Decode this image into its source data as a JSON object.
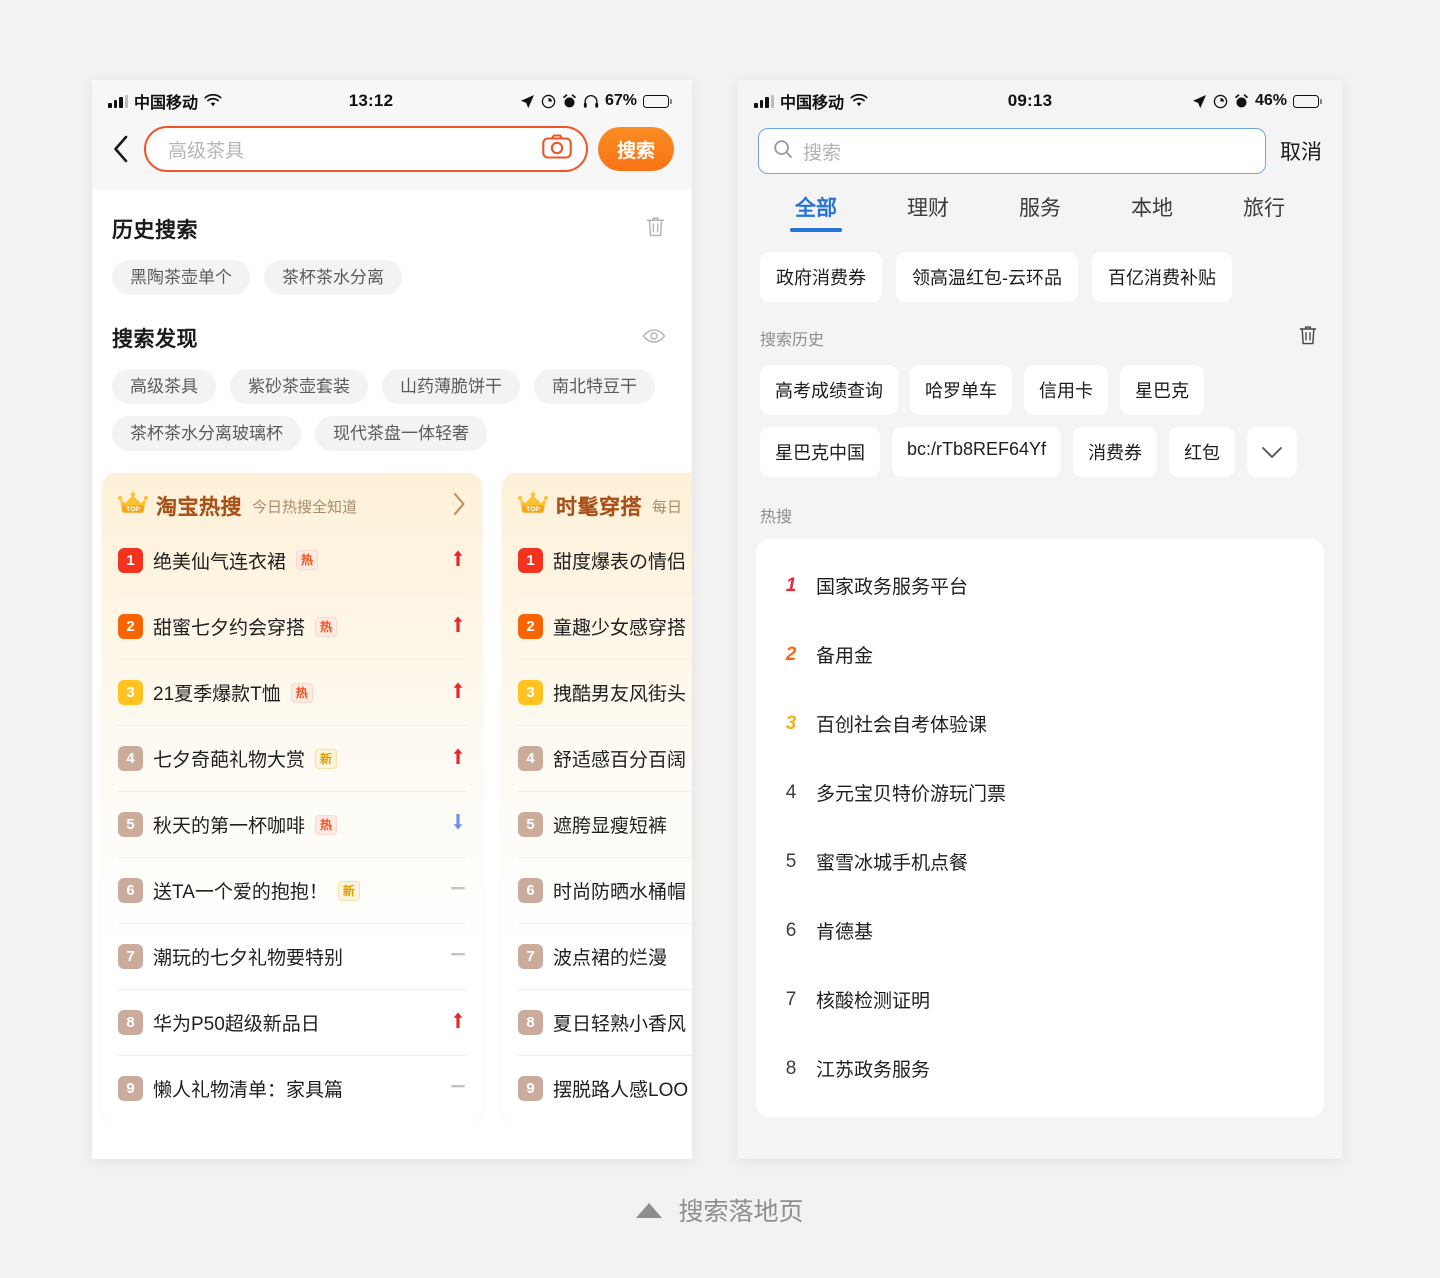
{
  "caption": {
    "text": "搜索落地页",
    "icon": "triangle-up-icon"
  },
  "left_phone": {
    "status": {
      "carrier": "中国移动",
      "time": "13:12",
      "battery_percent": "67%",
      "icons": [
        "signal-bars-icon",
        "wifi-icon",
        "location-arrow-icon",
        "do-not-disturb-icon",
        "alarm-icon",
        "headphones-icon",
        "battery-icon"
      ]
    },
    "search": {
      "back_icon": "chevron-left-icon",
      "placeholder": "高级茶具",
      "camera_icon": "camera-icon",
      "button_label": "搜索"
    },
    "history": {
      "title": "历史搜索",
      "delete_icon": "trash-icon",
      "items": [
        "黑陶茶壶单个",
        "茶杯茶水分离"
      ]
    },
    "discover": {
      "title": "搜索发现",
      "eye_icon": "eye-icon",
      "items": [
        "高级茶具",
        "紫砂茶壶套装",
        "山药薄脆饼干",
        "南北特豆干",
        "茶杯茶水分离玻璃杯",
        "现代茶盘一体轻奢"
      ]
    },
    "hot_cards": [
      {
        "crown_icon": "crown-top-icon",
        "title": "淘宝热搜",
        "subtitle": "今日热搜全知道",
        "arrow_icon": "chevron-right-icon",
        "rows": [
          {
            "rank": "1",
            "rank_color": "#f4321f",
            "text": "绝美仙气连衣裙",
            "badge": "热",
            "badge_type": "hot",
            "trend": "up"
          },
          {
            "rank": "2",
            "rank_color": "#fa6400",
            "text": "甜蜜七夕约会穿搭",
            "badge": "热",
            "badge_type": "hot",
            "trend": "up"
          },
          {
            "rank": "3",
            "rank_color": "#ffc41f",
            "text": "21夏季爆款T恤",
            "badge": "热",
            "badge_type": "hot",
            "trend": "up"
          },
          {
            "rank": "4",
            "rank_color": "#cbab9c",
            "text": "七夕奇葩礼物大赏",
            "badge": "新",
            "badge_type": "new",
            "trend": "up"
          },
          {
            "rank": "5",
            "rank_color": "#cbab9c",
            "text": "秋天的第一杯咖啡",
            "badge": "热",
            "badge_type": "hot",
            "trend": "down"
          },
          {
            "rank": "6",
            "rank_color": "#cbab9c",
            "text": "送TA一个爱的抱抱！",
            "badge": "新",
            "badge_type": "new",
            "trend": "flat"
          },
          {
            "rank": "7",
            "rank_color": "#cbab9c",
            "text": "潮玩的七夕礼物要特别",
            "badge": "",
            "badge_type": "",
            "trend": "flat"
          },
          {
            "rank": "8",
            "rank_color": "#cbab9c",
            "text": "华为P50超级新品日",
            "badge": "",
            "badge_type": "",
            "trend": "up"
          },
          {
            "rank": "9",
            "rank_color": "#cbab9c",
            "text": "懒人礼物清单：家具篇",
            "badge": "",
            "badge_type": "",
            "trend": "flat"
          }
        ]
      },
      {
        "crown_icon": "crown-top-icon",
        "title": "时髦穿搭",
        "subtitle": "每日",
        "arrow_icon": "chevron-right-icon",
        "rows": [
          {
            "rank": "1",
            "rank_color": "#f4321f",
            "text": "甜度爆表の情侣",
            "badge": "",
            "badge_type": "",
            "trend": ""
          },
          {
            "rank": "2",
            "rank_color": "#fa6400",
            "text": "童趣少女感穿搭",
            "badge": "",
            "badge_type": "",
            "trend": ""
          },
          {
            "rank": "3",
            "rank_color": "#ffc41f",
            "text": "拽酷男友风街头",
            "badge": "",
            "badge_type": "",
            "trend": ""
          },
          {
            "rank": "4",
            "rank_color": "#cbab9c",
            "text": "舒适感百分百阔",
            "badge": "",
            "badge_type": "",
            "trend": ""
          },
          {
            "rank": "5",
            "rank_color": "#cbab9c",
            "text": "遮胯显瘦短裤",
            "badge": "",
            "badge_type": "",
            "trend": ""
          },
          {
            "rank": "6",
            "rank_color": "#cbab9c",
            "text": "时尚防晒水桶帽",
            "badge": "",
            "badge_type": "",
            "trend": ""
          },
          {
            "rank": "7",
            "rank_color": "#cbab9c",
            "text": "波点裙的烂漫",
            "badge": "",
            "badge_type": "",
            "trend": ""
          },
          {
            "rank": "8",
            "rank_color": "#cbab9c",
            "text": "夏日轻熟小香风",
            "badge": "",
            "badge_type": "",
            "trend": ""
          },
          {
            "rank": "9",
            "rank_color": "#cbab9c",
            "text": "摆脱路人感LOO",
            "badge": "",
            "badge_type": "",
            "trend": ""
          }
        ]
      }
    ]
  },
  "right_phone": {
    "status": {
      "carrier": "中国移动",
      "time": "09:13",
      "battery_percent": "46%",
      "icons": [
        "signal-bars-icon",
        "wifi-icon",
        "location-arrow-icon",
        "do-not-disturb-icon",
        "alarm-icon",
        "battery-icon"
      ]
    },
    "search": {
      "search_icon": "search-icon",
      "placeholder": "搜索",
      "cancel_label": "取消"
    },
    "tabs": [
      {
        "label": "全部",
        "active": true
      },
      {
        "label": "理财",
        "active": false
      },
      {
        "label": "服务",
        "active": false
      },
      {
        "label": "本地",
        "active": false
      },
      {
        "label": "旅行",
        "active": false
      }
    ],
    "promos": [
      "政府消费券",
      "领高温红包-云环品",
      "百亿消费补贴"
    ],
    "history": {
      "label": "搜索历史",
      "delete_icon": "trash-icon",
      "expand_icon": "chevron-down-icon",
      "items": [
        "高考成绩查询",
        "哈罗单车",
        "信用卡",
        "星巴克",
        "星巴克中国",
        "bc:/rTb8REF64Yf",
        "消费券",
        "红包"
      ]
    },
    "hot": {
      "label": "热搜",
      "rows": [
        {
          "rank": "1",
          "text": "国家政务服务平台"
        },
        {
          "rank": "2",
          "text": "备用金"
        },
        {
          "rank": "3",
          "text": "百创社会自考体验课"
        },
        {
          "rank": "4",
          "text": "多元宝贝特价游玩门票"
        },
        {
          "rank": "5",
          "text": "蜜雪冰城手机点餐"
        },
        {
          "rank": "6",
          "text": "肯德基"
        },
        {
          "rank": "7",
          "text": "核酸检测证明"
        },
        {
          "rank": "8",
          "text": "江苏政务服务"
        }
      ]
    }
  },
  "colors": {
    "left_accent": "#f0552a",
    "right_accent": "#2574d8",
    "background": "#f2f2f2"
  }
}
